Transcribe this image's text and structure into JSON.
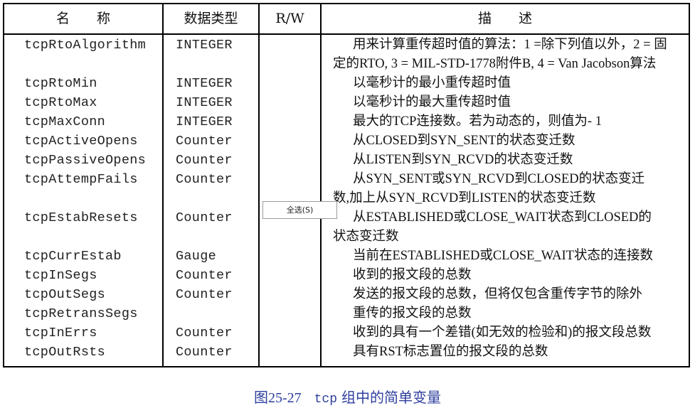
{
  "table": {
    "headers": {
      "name": "名　　称",
      "type": "数据类型",
      "rw": "R/W",
      "desc": "描　　述"
    },
    "rows": [
      {
        "name": "tcpRtoAlgorithm",
        "type": "INTEGER",
        "desc": [
          "用来计算重传超时值的算法：1 =除下列值以外，2 = 固",
          "定的RTO, 3 = MIL-STD-1778附件B, 4 = Van Jacobson算法"
        ]
      },
      {
        "name": "tcpRtoMin",
        "type": "INTEGER",
        "desc": [
          "以毫秒计的最小重传超时值"
        ]
      },
      {
        "name": "tcpRtoMax",
        "type": "INTEGER",
        "desc": [
          "以毫秒计的最大重传超时值"
        ]
      },
      {
        "name": "tcpMaxConn",
        "type": "INTEGER",
        "desc": [
          "最大的TCP连接数。若为动态的，则值为- 1"
        ]
      },
      {
        "name": "tcpActiveOpens",
        "type": "Counter",
        "desc": [
          "从CLOSED到SYN_SENT的状态变迁数"
        ]
      },
      {
        "name": "tcpPassiveOpens",
        "type": "Counter",
        "desc": [
          "从LISTEN到SYN_RCVD的状态变迁数"
        ]
      },
      {
        "name": "tcpAttempFails",
        "type": "Counter",
        "desc": [
          "从SYN_SENT或SYN_RCVD到CLOSED的状态变迁",
          "数,加上从SYN_RCVD到LISTEN的状态变迁数"
        ]
      },
      {
        "name": "tcpEstabResets",
        "type": "Counter",
        "desc": [
          "从ESTABLISHED或CLOSE_WAIT状态到CLOSED的",
          "状态变迁数"
        ]
      },
      {
        "name": "tcpCurrEstab",
        "type": "Gauge",
        "desc": [
          "当前在ESTABLISHED或CLOSE_WAIT状态的连接数"
        ]
      },
      {
        "name": "tcpInSegs",
        "type": "Counter",
        "desc": [
          "收到的报文段的总数"
        ]
      },
      {
        "name": "tcpOutSegs",
        "type": "Counter",
        "desc": [
          "发送的报文段的总数，但将仅包含重传字节的除外"
        ]
      },
      {
        "name": "tcpRetransSegs",
        "type": "",
        "desc": [
          "重传的报文段的总数"
        ]
      },
      {
        "name": "tcpInErrs",
        "type": "Counter",
        "desc": [
          "收到的具有一个差错(如无效的检验和)的报文段总数"
        ]
      },
      {
        "name": "tcpOutRsts",
        "type": "Counter",
        "desc": [
          "具有RST标志置位的报文段的总数"
        ]
      }
    ]
  },
  "context_menu": {
    "select_all_label": "全选(S)"
  },
  "caption": {
    "figure": "图25-27",
    "code": "tcp",
    "text": "组中的简单变量"
  }
}
